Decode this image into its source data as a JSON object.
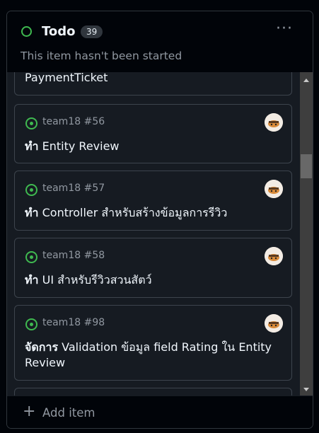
{
  "column": {
    "title": "Todo",
    "count": "39",
    "description": "This item hasn't been started",
    "more_label": "···"
  },
  "cards": [
    {
      "ref": "",
      "title_prefix": "",
      "title_rest": "PaymentTicket"
    },
    {
      "ref": "team18 #56",
      "title_prefix": "ทำ",
      "title_rest": " Entity Review"
    },
    {
      "ref": "team18 #57",
      "title_prefix": "ทำ",
      "title_rest": " Controller สำหรับสร้างข้อมูลการรีวิว"
    },
    {
      "ref": "team18 #58",
      "title_prefix": "ทำ",
      "title_rest": " UI สำหรับรีวิวสวนสัตว์"
    },
    {
      "ref": "team18 #98",
      "title_prefix": "จัดการ",
      "title_rest": " Validation ข้อมูล field Rating ใน Entity Review"
    }
  ],
  "footer": {
    "plus": "+",
    "add_label": "Add item"
  },
  "colors": {
    "open_status": "#3fb950",
    "background": "#010409",
    "card_bg": "#161b22",
    "border": "#3d444d"
  }
}
